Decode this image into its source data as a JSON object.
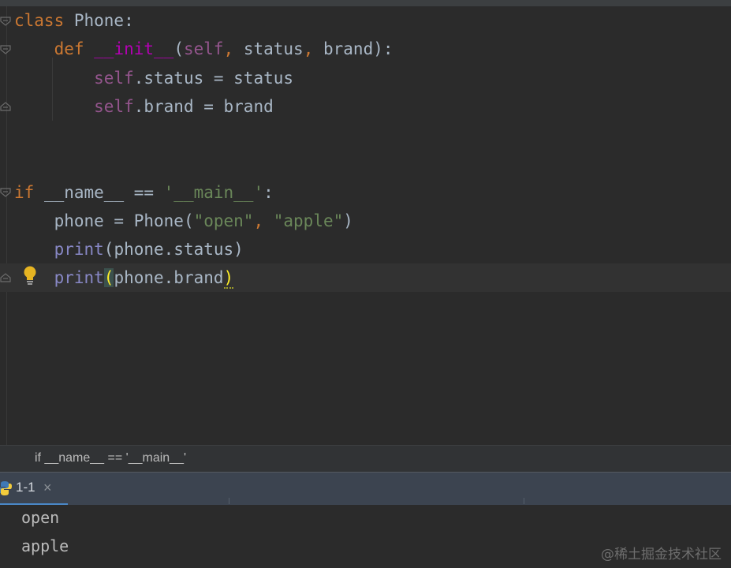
{
  "editor": {
    "lines": [
      {
        "tokens": [
          {
            "t": "class ",
            "c": "kw"
          },
          {
            "t": "Phone",
            "c": ""
          },
          {
            "t": ":",
            "c": ""
          }
        ]
      },
      {
        "tokens": [
          {
            "t": "    "
          },
          {
            "t": "def ",
            "c": "kw"
          },
          {
            "t": "__init__",
            "c": "magic"
          },
          {
            "t": "(",
            "c": ""
          },
          {
            "t": "self",
            "c": "self"
          },
          {
            "t": ", ",
            "c": "kw"
          },
          {
            "t": "status",
            "c": ""
          },
          {
            "t": ", ",
            "c": "kw"
          },
          {
            "t": "brand",
            "c": ""
          },
          {
            "t": "):",
            "c": ""
          }
        ]
      },
      {
        "tokens": [
          {
            "t": "        "
          },
          {
            "t": "self",
            "c": "self"
          },
          {
            "t": ".status = status",
            "c": ""
          }
        ]
      },
      {
        "tokens": [
          {
            "t": "        "
          },
          {
            "t": "self",
            "c": "self"
          },
          {
            "t": ".brand = brand",
            "c": ""
          }
        ]
      },
      {
        "tokens": []
      },
      {
        "tokens": []
      },
      {
        "tokens": [
          {
            "t": "if ",
            "c": "kw"
          },
          {
            "t": "__name__ == ",
            "c": ""
          },
          {
            "t": "'__main__'",
            "c": "str"
          },
          {
            "t": ":",
            "c": ""
          }
        ]
      },
      {
        "tokens": [
          {
            "t": "    "
          },
          {
            "t": "phone = Phone(",
            "c": ""
          },
          {
            "t": "\"open\"",
            "c": "str"
          },
          {
            "t": ", ",
            "c": "kw"
          },
          {
            "t": "\"apple\"",
            "c": "str"
          },
          {
            "t": ")",
            "c": ""
          }
        ]
      },
      {
        "tokens": [
          {
            "t": "    "
          },
          {
            "t": "print",
            "c": "builtin"
          },
          {
            "t": "(phone.status)",
            "c": ""
          }
        ]
      },
      {
        "tokens": [
          {
            "t": "    "
          },
          {
            "t": "print",
            "c": "builtin"
          },
          {
            "t": "(",
            "c": "brace-hl"
          },
          {
            "t": "phone.brand",
            "c": ""
          },
          {
            "t": ")",
            "c": "brace-hl2 wavy"
          }
        ]
      }
    ]
  },
  "breadcrumb": "if __name__ == '__main__'",
  "run_tab": {
    "label": "1-1",
    "close": "×"
  },
  "console": {
    "output": [
      "open",
      "apple"
    ]
  },
  "watermark": "@稀土掘金技术社区",
  "colors": {
    "background": "#2b2b2b",
    "keyword": "#cc7832",
    "string": "#6a8759",
    "self": "#94558d",
    "builtin": "#8888c6",
    "accent": "#4a88c7"
  }
}
